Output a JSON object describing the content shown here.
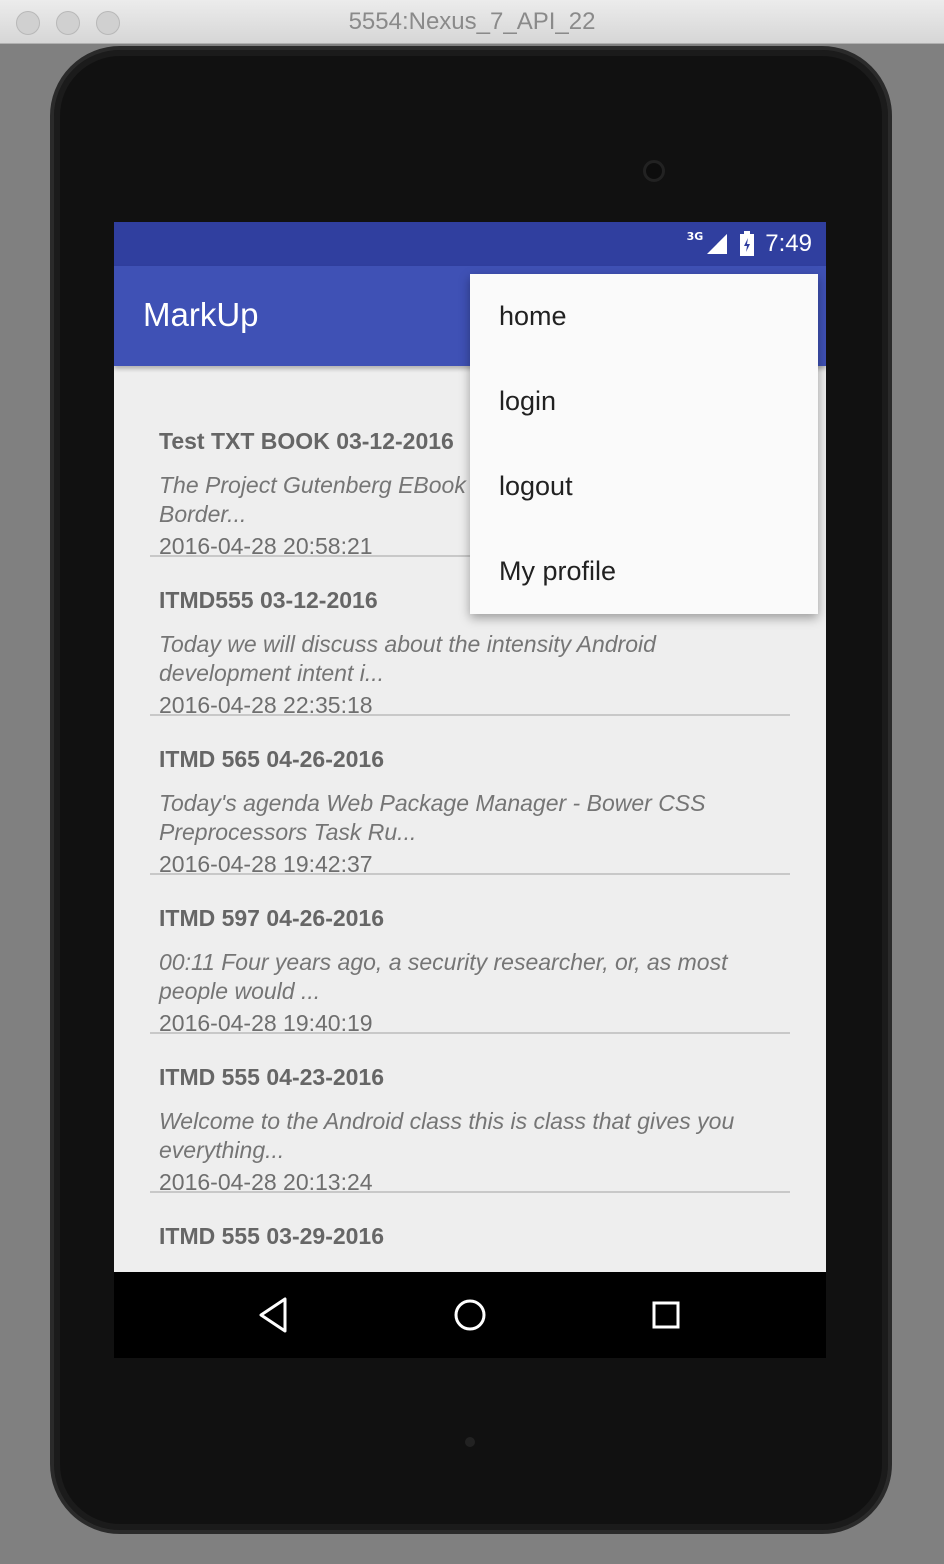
{
  "window": {
    "title": "5554:Nexus_7_API_22"
  },
  "status_bar": {
    "network": "3G",
    "time": "7:49",
    "signal_icon": "signal-icon",
    "battery_icon": "battery-icon"
  },
  "app_bar": {
    "title": "MarkUp"
  },
  "menu": {
    "items": [
      {
        "label": "home"
      },
      {
        "label": "login"
      },
      {
        "label": "logout"
      },
      {
        "label": "My profile"
      }
    ]
  },
  "notes": [
    {
      "title": "Test TXT BOOK 03-12-2016",
      "snippet": "The Project Gutenberg EBook of A Little Romance of Border...",
      "date": "2016-04-28 20:58:21"
    },
    {
      "title": "ITMD555 03-12-2016",
      "snippet": "Today we will discuss about the intensity Android development intent i...",
      "date": "2016-04-28 22:35:18"
    },
    {
      "title": "ITMD 565 04-26-2016",
      "snippet": "Today's agenda Web Package Manager - Bower  CSS Preprocessors  Task Ru...",
      "date": "2016-04-28 19:42:37"
    },
    {
      "title": "ITMD 597 04-26-2016",
      "snippet": "00:11 Four years ago, a security researcher, or, as most people would ...",
      "date": "2016-04-28 19:40:19"
    },
    {
      "title": "ITMD 555 04-23-2016",
      "snippet": " Welcome to the Android class  this is class that gives you everything...",
      "date": "2016-04-28 20:13:24"
    },
    {
      "title": "ITMD 555 03-29-2016",
      "snippet": "",
      "date": ""
    }
  ],
  "nav_bar": {
    "back_icon": "back-icon",
    "home_icon": "home-icon",
    "recents_icon": "recents-icon"
  }
}
